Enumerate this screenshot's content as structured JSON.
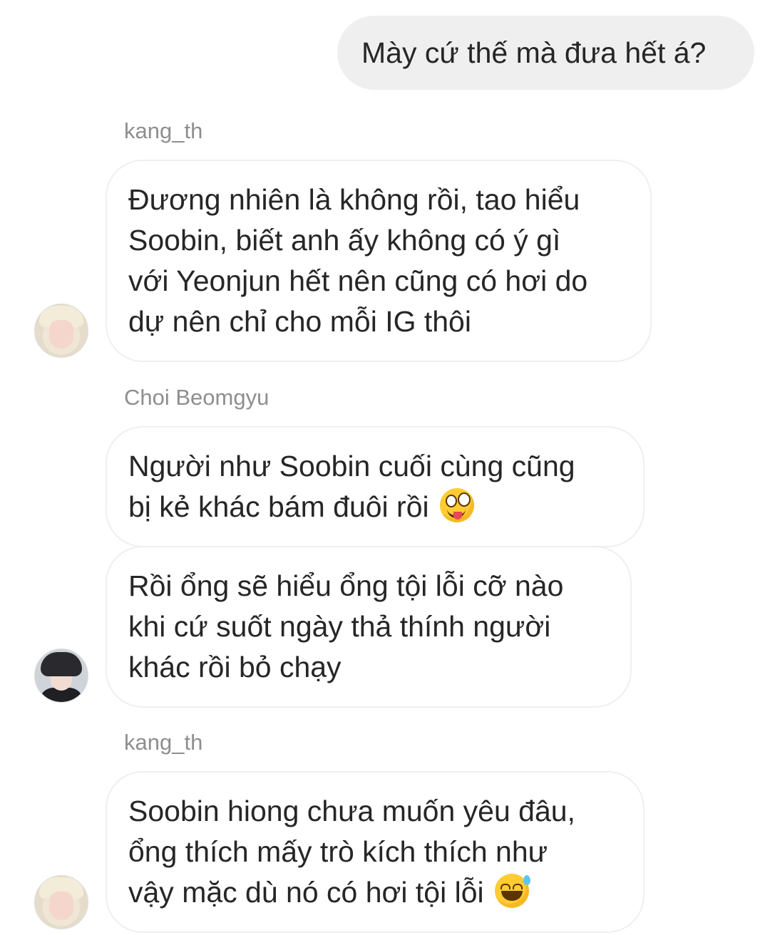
{
  "outgoing": {
    "text": "Mày cứ thế mà đưa hết á?"
  },
  "messages": [
    {
      "sender": "kang_th",
      "lines": [
        "Đương nhiên là không rồi, tao hiểu",
        "Soobin, biết anh ấy không có ý gì",
        "với Yeonjun hết nên cũng có hơi do",
        "dự nên chỉ cho mỗi IG thôi"
      ]
    },
    {
      "sender": "Choi Beomgyu",
      "lines": [
        "Người như Soobin cuối cùng cũng",
        "bị kẻ khác bám đuôi rồi"
      ],
      "emoji": "zany-face-icon"
    },
    {
      "lines": [
        "Rồi ổng sẽ hiểu ổng tội lỗi cỡ nào",
        "khi cứ suốt ngày thả thính người",
        "khác rồi bỏ chạy"
      ]
    },
    {
      "sender": "kang_th",
      "lines": [
        "Soobin hiong chưa muốn yêu đâu,",
        "ổng thích mấy trò kích thích như",
        "vậy mặc dù nó có hơi tội lỗi"
      ],
      "emoji": "grinning-sweat-icon"
    }
  ],
  "colors": {
    "outgoing_bubble": "#efefef",
    "incoming_border": "#efefef",
    "sender_name": "#8e8e8e",
    "text": "#262626"
  }
}
